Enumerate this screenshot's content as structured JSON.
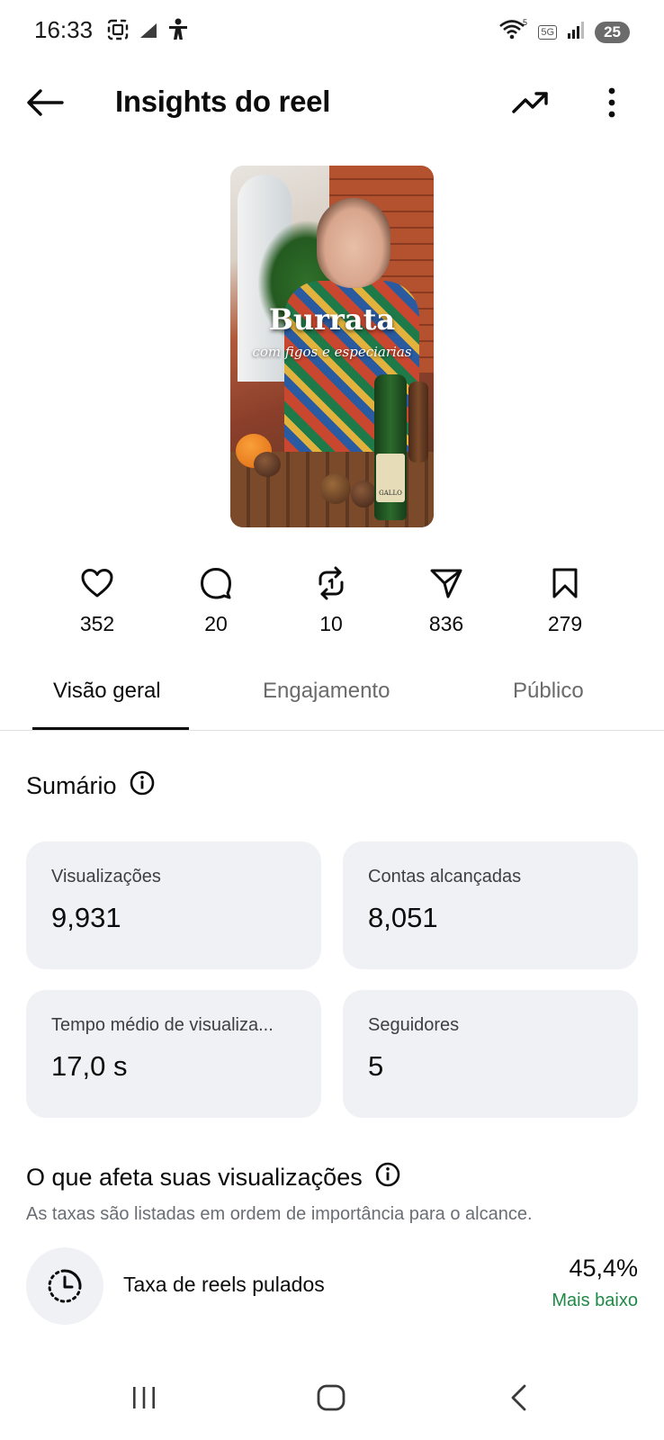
{
  "status_bar": {
    "time": "16:33",
    "wifi_label": "5",
    "network": "5G",
    "battery": "25"
  },
  "header": {
    "title": "Insights do reel"
  },
  "thumbnail": {
    "title": "Burrata",
    "subtitle": "com figos e especiarias",
    "bottle_brand": "GALLO"
  },
  "interactions": [
    {
      "icon": "heart-icon",
      "value": "352"
    },
    {
      "icon": "comment-icon",
      "value": "20"
    },
    {
      "icon": "repost-icon",
      "value": "10"
    },
    {
      "icon": "share-icon",
      "value": "836"
    },
    {
      "icon": "bookmark-icon",
      "value": "279"
    }
  ],
  "tabs": [
    {
      "label": "Visão geral",
      "active": true
    },
    {
      "label": "Engajamento",
      "active": false
    },
    {
      "label": "Público",
      "active": false
    }
  ],
  "summary": {
    "title": "Sumário",
    "cards": [
      {
        "label": "Visualizações",
        "value": "9,931"
      },
      {
        "label": "Contas alcançadas",
        "value": "8,051"
      },
      {
        "label": "Tempo médio de visualiza...",
        "value": "17,0 s"
      },
      {
        "label": "Seguidores",
        "value": "5"
      }
    ]
  },
  "affects": {
    "title": "O que afeta suas visualizações",
    "subtitle": "As taxas são listadas em ordem de importância para o alcance.",
    "rows": [
      {
        "label": "Taxa de reels pulados",
        "value": "45,4%",
        "status": "Mais baixo",
        "status_color": "#1f8a46"
      }
    ]
  }
}
